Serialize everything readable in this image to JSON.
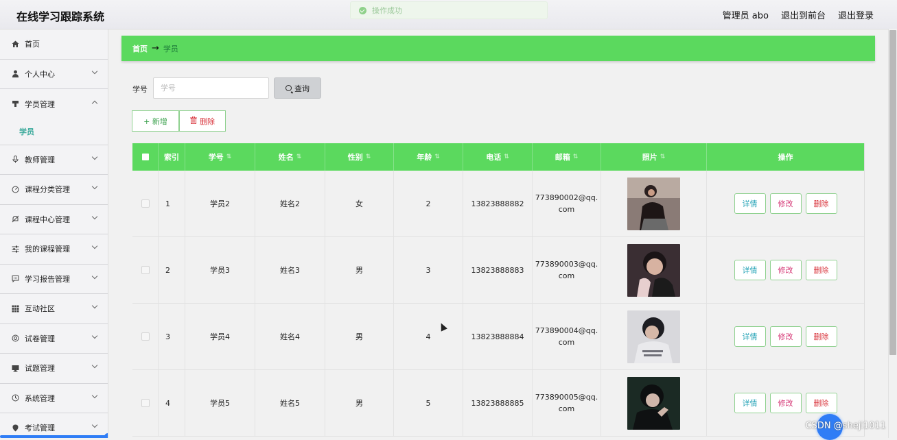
{
  "app": {
    "title": "在线学习跟踪系统"
  },
  "header": {
    "admin": "管理员 abo",
    "to_front": "退出到前台",
    "logout": "退出登录"
  },
  "toast": {
    "message": "操作成功"
  },
  "sidebar": {
    "items": [
      {
        "label": "首页",
        "icon": "home-icon"
      },
      {
        "label": "个人中心",
        "icon": "user-icon"
      },
      {
        "label": "学员管理",
        "icon": "stamp-icon"
      },
      {
        "label": "教师管理",
        "icon": "mic-icon"
      },
      {
        "label": "课程分类管理",
        "icon": "dashboard-icon"
      },
      {
        "label": "课程中心管理",
        "icon": "bell-icon"
      },
      {
        "label": "我的课程管理",
        "icon": "sliders-icon"
      },
      {
        "label": "学习报告管理",
        "icon": "chat-icon"
      },
      {
        "label": "互动社区",
        "icon": "grid-icon"
      },
      {
        "label": "试卷管理",
        "icon": "target-icon"
      },
      {
        "label": "试题管理",
        "icon": "monitor-icon"
      },
      {
        "label": "系统管理",
        "icon": "clock-icon"
      },
      {
        "label": "考试管理",
        "icon": "pin-icon"
      }
    ],
    "submenu": {
      "label": "学员"
    }
  },
  "breadcrumb": {
    "home": "首页",
    "arrow": "→",
    "current": "学员"
  },
  "search": {
    "label": "学号",
    "placeholder": "学号",
    "button": "查询"
  },
  "actions": {
    "add": "+ 新增",
    "delete": "删除"
  },
  "table": {
    "columns": [
      "",
      "索引",
      "学号",
      "姓名",
      "性别",
      "年龄",
      "电话",
      "邮箱",
      "照片",
      "操作"
    ],
    "rows": [
      {
        "index": "1",
        "student_no": "学员2",
        "name": "姓名2",
        "gender": "女",
        "age": "2",
        "phone": "13823888882",
        "email": "773890002@qq.com"
      },
      {
        "index": "2",
        "student_no": "学员3",
        "name": "姓名3",
        "gender": "男",
        "age": "3",
        "phone": "13823888883",
        "email": "773890003@qq.com"
      },
      {
        "index": "3",
        "student_no": "学员4",
        "name": "姓名4",
        "gender": "男",
        "age": "4",
        "phone": "13823888884",
        "email": "773890004@qq.com"
      },
      {
        "index": "4",
        "student_no": "学员5",
        "name": "姓名5",
        "gender": "男",
        "age": "5",
        "phone": "13823888885",
        "email": "773890005@qq.com"
      }
    ],
    "row_actions": {
      "detail": "详情",
      "edit": "修改",
      "remove": "删除"
    }
  },
  "watermark": "CSDN @sheji1011",
  "colors": {
    "accent": "#5bd95e",
    "link": "#3aa99b"
  }
}
